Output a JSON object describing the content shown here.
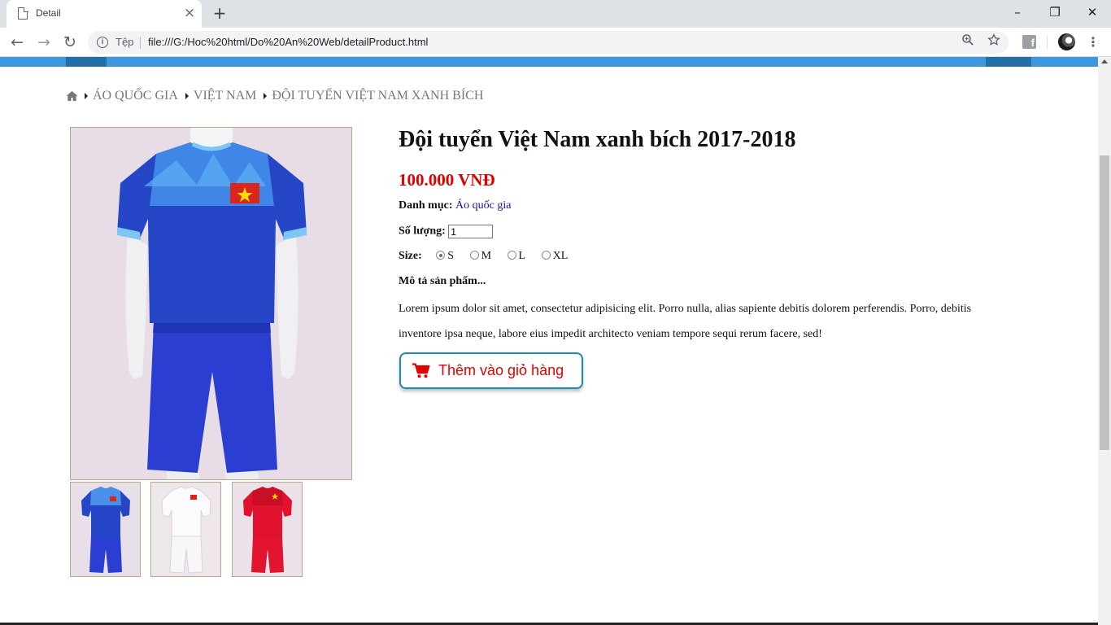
{
  "browser": {
    "tab_title": "Detail",
    "tab_close_glyph": "×",
    "new_tab_glyph": "+",
    "window_buttons": [
      "–",
      "❐",
      "✕"
    ],
    "nav": {
      "back": "←",
      "forward": "→",
      "reload": "↻"
    },
    "omnibox": {
      "scheme_label": "Tệp",
      "url": "file:///G:/Hoc%20html/Do%20An%20Web/detailProduct.html"
    },
    "icons": [
      "file-icon",
      "info-icon",
      "zoom-icon",
      "star-icon",
      "facebook-extension-icon",
      "profile-avatar",
      "menu-icon"
    ]
  },
  "breadcrumb": {
    "items": [
      "ÁO QUỐC GIA",
      "VIỆT NAM",
      "ĐỘI TUYỂN VIỆT NAM XANH BÍCH"
    ]
  },
  "product": {
    "title": "Đội tuyển Việt Nam xanh bích 2017-2018",
    "price": "100.000 VNĐ",
    "category_label": "Danh mục:",
    "category_value": "Áo quốc gia",
    "quantity_label": "Số lượng:",
    "quantity_value": "1",
    "size_label": "Size:",
    "sizes": [
      "S",
      "M",
      "L",
      "XL"
    ],
    "selected_size": "S",
    "description_label": "Mô tả sản phẩm...",
    "description": "Lorem ipsum dolor sit amet, consectetur adipisicing elit. Porro nulla, alias sapiente debitis dolorem perferendis. Porro, debitis inventore ipsa neque, labore eius impedit architecto veniam tempore sequi rerum facere, sed!",
    "add_to_cart_label": "Thêm vào giỏ hàng",
    "thumbnails": [
      "blue-kit",
      "white-kit",
      "red-kit"
    ]
  },
  "colors": {
    "accent_bar": "#3e96dc",
    "price_red": "#e00000",
    "button_border": "#1d8ab0",
    "link": "#1a0dab"
  }
}
